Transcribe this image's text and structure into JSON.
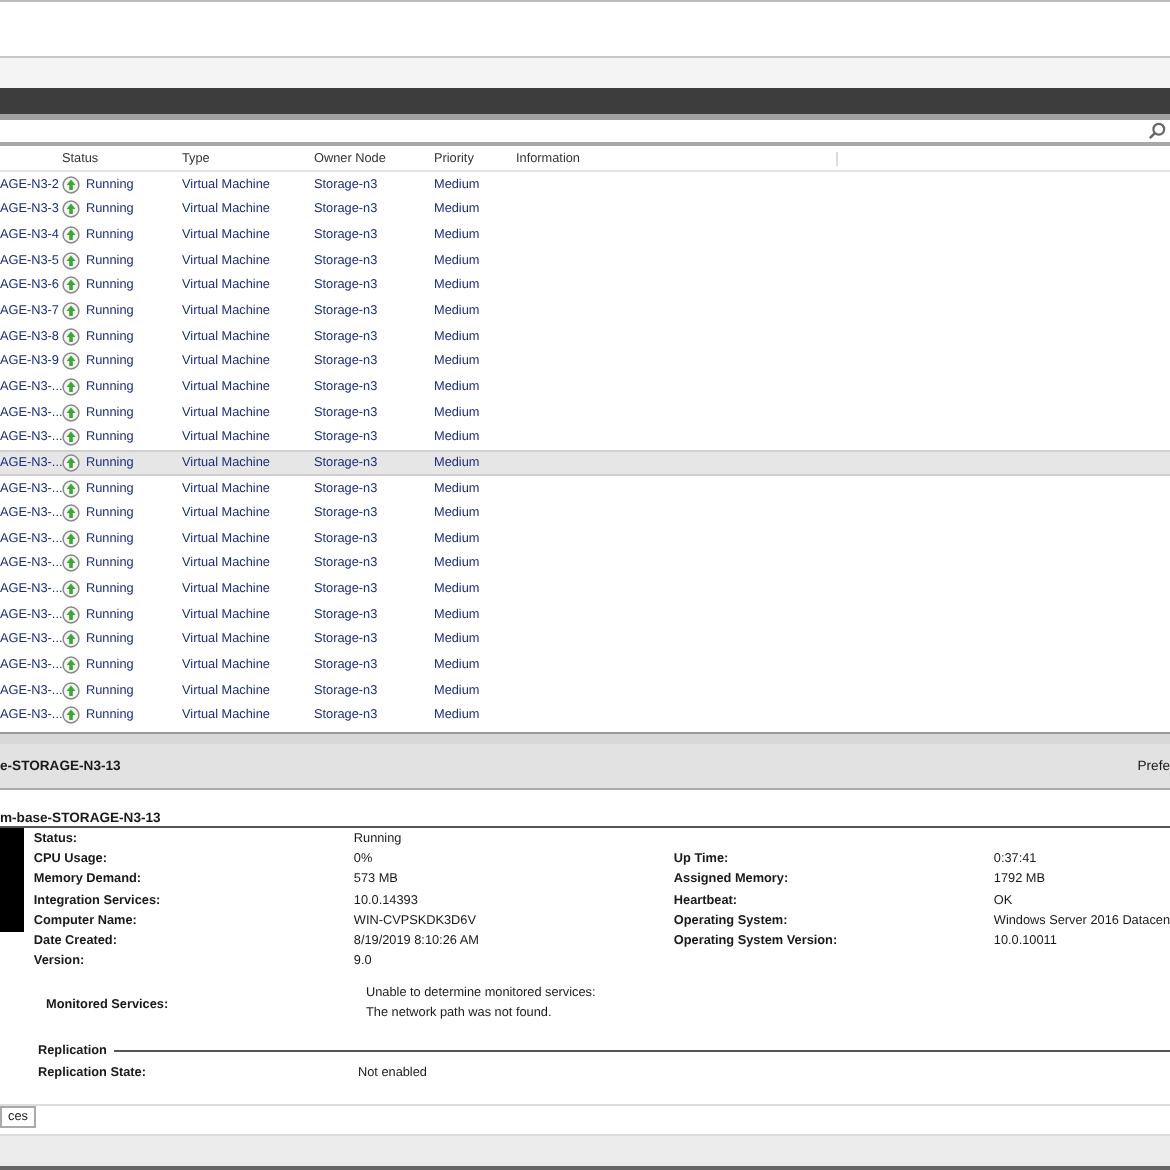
{
  "table": {
    "columns": [
      {},
      {
        "label": "Status"
      },
      {
        "label": "Type"
      },
      {
        "label": "Owner Node"
      },
      {
        "label": "Priority"
      },
      {
        "label": "Information"
      }
    ],
    "rows": [
      {
        "name": "AGE-N3-2",
        "status": "Running",
        "type": "Virtual Machine",
        "owner": "Storage-n3",
        "priority": "Medium",
        "selected": false
      },
      {
        "name": "AGE-N3-3",
        "status": "Running",
        "type": "Virtual Machine",
        "owner": "Storage-n3",
        "priority": "Medium",
        "selected": false
      },
      {
        "name": "AGE-N3-4",
        "status": "Running",
        "type": "Virtual Machine",
        "owner": "Storage-n3",
        "priority": "Medium",
        "selected": false
      },
      {
        "name": "AGE-N3-5",
        "status": "Running",
        "type": "Virtual Machine",
        "owner": "Storage-n3",
        "priority": "Medium",
        "selected": false
      },
      {
        "name": "AGE-N3-6",
        "status": "Running",
        "type": "Virtual Machine",
        "owner": "Storage-n3",
        "priority": "Medium",
        "selected": false
      },
      {
        "name": "AGE-N3-7",
        "status": "Running",
        "type": "Virtual Machine",
        "owner": "Storage-n3",
        "priority": "Medium",
        "selected": false
      },
      {
        "name": "AGE-N3-8",
        "status": "Running",
        "type": "Virtual Machine",
        "owner": "Storage-n3",
        "priority": "Medium",
        "selected": false
      },
      {
        "name": "AGE-N3-9",
        "status": "Running",
        "type": "Virtual Machine",
        "owner": "Storage-n3",
        "priority": "Medium",
        "selected": false
      },
      {
        "name": "AGE-N3-...",
        "status": "Running",
        "type": "Virtual Machine",
        "owner": "Storage-n3",
        "priority": "Medium",
        "selected": false
      },
      {
        "name": "AGE-N3-...",
        "status": "Running",
        "type": "Virtual Machine",
        "owner": "Storage-n3",
        "priority": "Medium",
        "selected": false
      },
      {
        "name": "AGE-N3-...",
        "status": "Running",
        "type": "Virtual Machine",
        "owner": "Storage-n3",
        "priority": "Medium",
        "selected": false
      },
      {
        "name": "AGE-N3-...",
        "status": "Running",
        "type": "Virtual Machine",
        "owner": "Storage-n3",
        "priority": "Medium",
        "selected": true
      },
      {
        "name": "AGE-N3-...",
        "status": "Running",
        "type": "Virtual Machine",
        "owner": "Storage-n3",
        "priority": "Medium",
        "selected": false
      },
      {
        "name": "AGE-N3-...",
        "status": "Running",
        "type": "Virtual Machine",
        "owner": "Storage-n3",
        "priority": "Medium",
        "selected": false
      },
      {
        "name": "AGE-N3-...",
        "status": "Running",
        "type": "Virtual Machine",
        "owner": "Storage-n3",
        "priority": "Medium",
        "selected": false
      },
      {
        "name": "AGE-N3-...",
        "status": "Running",
        "type": "Virtual Machine",
        "owner": "Storage-n3",
        "priority": "Medium",
        "selected": false
      },
      {
        "name": "AGE-N3-...",
        "status": "Running",
        "type": "Virtual Machine",
        "owner": "Storage-n3",
        "priority": "Medium",
        "selected": false
      },
      {
        "name": "AGE-N3-...",
        "status": "Running",
        "type": "Virtual Machine",
        "owner": "Storage-n3",
        "priority": "Medium",
        "selected": false
      },
      {
        "name": "AGE-N3-...",
        "status": "Running",
        "type": "Virtual Machine",
        "owner": "Storage-n3",
        "priority": "Medium",
        "selected": false
      },
      {
        "name": "AGE-N3-...",
        "status": "Running",
        "type": "Virtual Machine",
        "owner": "Storage-n3",
        "priority": "Medium",
        "selected": false
      },
      {
        "name": "AGE-N3-...",
        "status": "Running",
        "type": "Virtual Machine",
        "owner": "Storage-n3",
        "priority": "Medium",
        "selected": false
      },
      {
        "name": "AGE-N3-...",
        "status": "Running",
        "type": "Virtual Machine",
        "owner": "Storage-n3",
        "priority": "Medium",
        "selected": false
      }
    ]
  },
  "details_header": {
    "title": "e-STORAGE-N3-13",
    "right_label": "Prefe"
  },
  "details": {
    "title": "m-base-STORAGE-N3-13",
    "left": [
      {
        "label": "Status:",
        "value": "Running"
      },
      {
        "label": "CPU Usage:",
        "value": "0%"
      },
      {
        "label": "Memory Demand:",
        "value": "573 MB"
      },
      {
        "label": "Integration Services:",
        "value": "10.0.14393"
      },
      {
        "label": "Computer Name:",
        "value": "WIN-CVPSKDK3D6V"
      },
      {
        "label": "Date Created:",
        "value": "8/19/2019 8:10:26 AM"
      },
      {
        "label": "Version:",
        "value": "9.0"
      }
    ],
    "right": [
      {
        "label": "Up Time:",
        "value": "0:37:41"
      },
      {
        "label": "Assigned Memory:",
        "value": "1792 MB"
      },
      {
        "label": "Heartbeat:",
        "value": "OK"
      },
      {
        "label": "Operating System:",
        "value": "Windows Server 2016 Datacen"
      },
      {
        "label": "Operating System Version:",
        "value": "10.0.10011"
      }
    ],
    "monitored": {
      "label": "Monitored Services:",
      "lines": [
        "Unable to determine monitored services:",
        "The network path was not found."
      ]
    },
    "replication": {
      "heading": "Replication",
      "label": "Replication State:",
      "value": "Not enabled"
    }
  },
  "bottom_tabs": [
    {
      "label": "ces",
      "selected": true
    }
  ]
}
